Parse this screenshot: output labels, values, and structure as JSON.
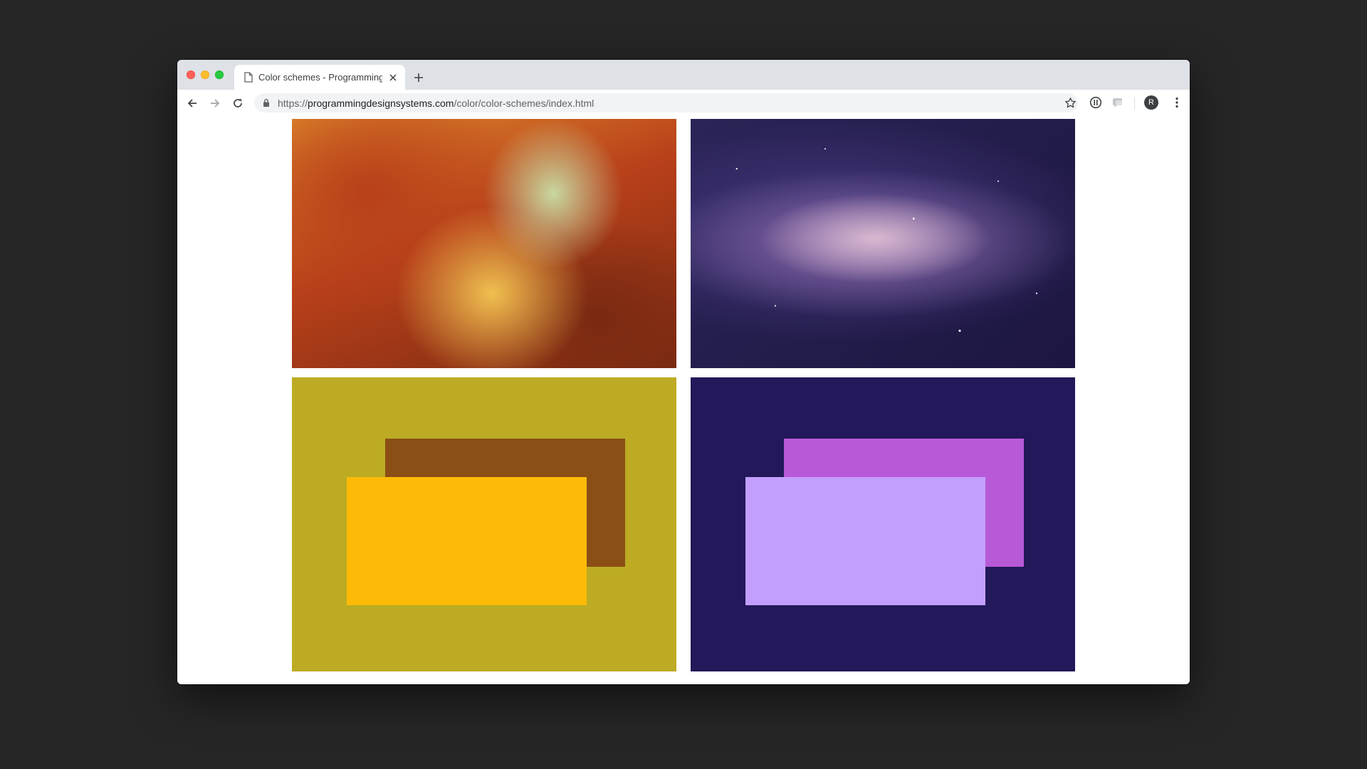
{
  "browser": {
    "tab_title": "Color schemes - Programming Design Systems",
    "url_scheme": "https://",
    "url_host": "programmingdesignsystems.com",
    "url_path": "/color/color-schemes/index.html",
    "avatar_initial": "R",
    "icons": [
      "page-icon",
      "close-icon",
      "plus-icon",
      "back-arrow-icon",
      "forward-arrow-icon",
      "reload-icon",
      "lock-icon",
      "star-icon",
      "info-extension-icon",
      "cast-extension-icon",
      "menu-dots-icon"
    ]
  },
  "photos": [
    {
      "subject": "autumn-forest-road",
      "colors": [
        "#b8401a",
        "#e08a2c",
        "#f0c050",
        "#7a2a12",
        "#c8d8a0"
      ]
    },
    {
      "subject": "milky-way-night-sky",
      "colors": [
        "#1c1640",
        "#4a3c82",
        "#8a6aa8",
        "#d8b8d0",
        "#2a2458"
      ]
    }
  ],
  "schemes": [
    {
      "background": "#bcab23",
      "back_rect": "#8b4f16",
      "front_rect": "#fdbb07"
    },
    {
      "background": "#22185a",
      "back_rect": "#b85ad7",
      "front_rect": "#c39ffd"
    }
  ]
}
